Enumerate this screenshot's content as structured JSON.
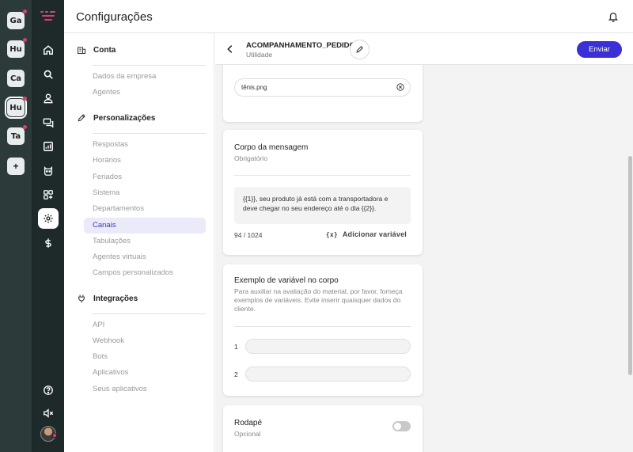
{
  "workspaces": [
    {
      "label": "Ga",
      "notification": true,
      "active": false
    },
    {
      "label": "Hu",
      "notification": true,
      "active": false
    },
    {
      "label": "Ca",
      "notification": false,
      "active": false
    },
    {
      "label": "Hu",
      "notification": true,
      "active": true
    },
    {
      "label": "Ta",
      "notification": true,
      "active": false
    }
  ],
  "workspace_add_label": "+",
  "nav": {
    "icons": [
      "home-icon",
      "search-icon",
      "user-icon",
      "chat-icon",
      "chart-icon",
      "bot-icon",
      "apps-icon",
      "settings-icon",
      "dollar-icon"
    ],
    "active": "settings-icon",
    "bottom_icons": [
      "help-icon",
      "mute-icon",
      "avatar"
    ]
  },
  "header": {
    "title": "Configurações"
  },
  "settings_nav": {
    "sections": [
      {
        "icon": "building-icon",
        "label": "Conta",
        "items": [
          "Dados da empresa",
          "Agentes"
        ]
      },
      {
        "icon": "pencil-icon",
        "label": "Personalizações",
        "items": [
          "Respostas",
          "Horários",
          "Feriados",
          "Sistema",
          "Departamentos",
          "Canais",
          "Tabulações",
          "Agentes virtuais",
          "Campos personalizados"
        ]
      },
      {
        "icon": "plug-icon",
        "label": "Integrações",
        "items": [
          "API",
          "Webhook",
          "Bots",
          "Aplicativos",
          "Seus aplicativos"
        ]
      }
    ],
    "active_item": "Canais"
  },
  "template": {
    "name": "ACOMPANHAMENTO_PEDIDO",
    "category": "Utilidade",
    "send_label": "Enviar"
  },
  "attachment": {
    "file_name": "tênis.png"
  },
  "body_card": {
    "title": "Corpo da mensagem",
    "subtitle": "Obrigatório",
    "message": "{{1}}, seu produto já está com a transportadora e deve chegar no seu endereço até o dia {{2}}.",
    "counter": "94 / 1024",
    "add_variable_icon": "{x}",
    "add_variable_label": "Adicionar variável"
  },
  "example_card": {
    "title": "Exemplo de variável no corpo",
    "description": "Para auxiliar na avaliação do material, por favor, forneça exemplos de variáveis. Evite inserir quaisquer dados do cliente.",
    "variables": [
      {
        "num": "1",
        "value": ""
      },
      {
        "num": "2",
        "value": ""
      }
    ]
  },
  "footer_card": {
    "title": "Rodapé",
    "subtitle": "Opcional",
    "enabled": false
  },
  "colors": {
    "accent": "#3b2fd6",
    "rail_bg": "#2d3a3a",
    "nav_bg": "#1e2a2a",
    "notification": "#e5397a",
    "active_item_bg": "#ebeaf8"
  }
}
